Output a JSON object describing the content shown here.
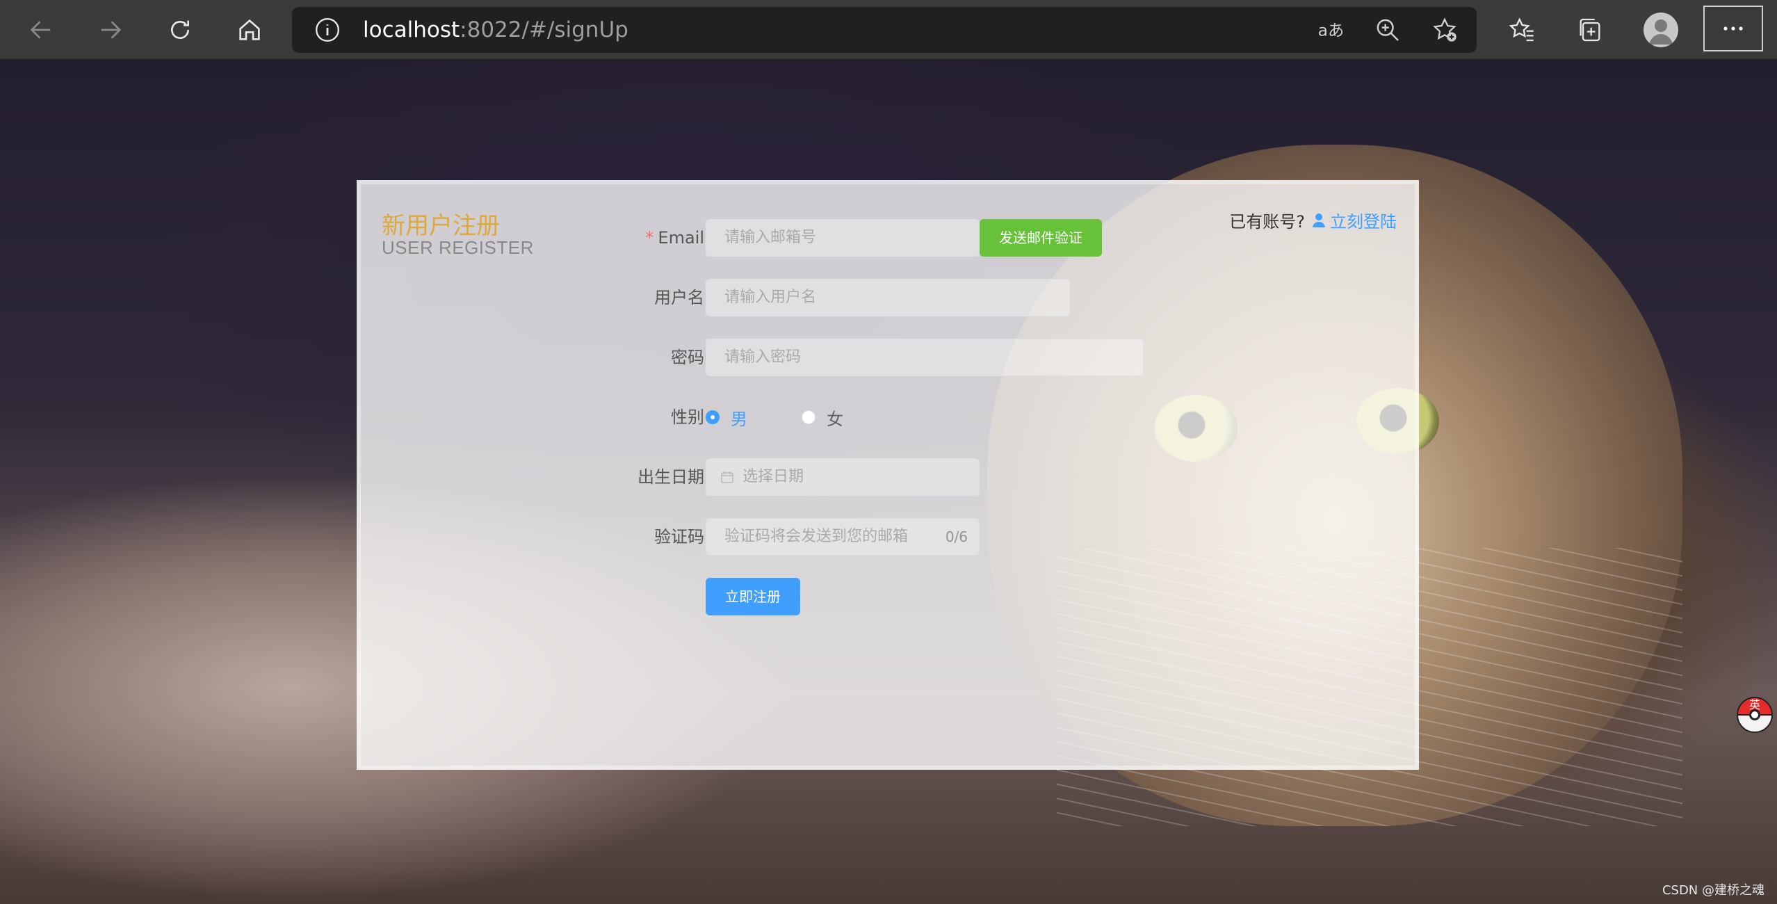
{
  "browser": {
    "url_host": "localhost",
    "url_rest": ":8022/#/signUp"
  },
  "form": {
    "title_cn": "新用户注册",
    "title_en": "USER REGISTER",
    "has_account_text": "已有账号?",
    "login_link": "立刻登陆",
    "email_required_mark": "*",
    "email_label": "Email",
    "email_placeholder": "请输入邮箱号",
    "send_button": "发送邮件验证",
    "username_label": "用户名",
    "username_placeholder": "请输入用户名",
    "password_label": "密码",
    "password_placeholder": "请输入密码",
    "gender_label": "性别",
    "gender_male": "男",
    "gender_female": "女",
    "gender_selected": "男",
    "birthday_label": "出生日期",
    "birthday_placeholder": "选择日期",
    "code_label": "验证码",
    "code_placeholder": "验证码将会发送到您的邮箱",
    "code_counter": "0/6",
    "submit_button": "立即注册"
  },
  "float_widget": {
    "label": "英"
  },
  "watermark": "CSDN @建桥之魂",
  "colors": {
    "title_orange": "#dca93b",
    "primary_blue": "#409eff",
    "success_green": "#67c23a",
    "required_red": "#f56c6c"
  }
}
